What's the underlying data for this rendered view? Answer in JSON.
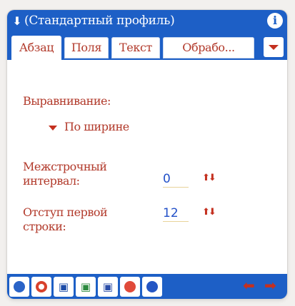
{
  "title_bar": {
    "arrow": "⬇",
    "title": "(Стандартный профиль)",
    "info": "i"
  },
  "tabs": [
    {
      "label": "Абзац",
      "active": true
    },
    {
      "label": "Поля",
      "active": false
    },
    {
      "label": "Текст",
      "active": false
    },
    {
      "label": "Обрабо...",
      "active": false
    }
  ],
  "content": {
    "alignment_label": "Выравнивание:",
    "alignment_value": "По ширине",
    "line_spacing_label_1": "Межстрочный",
    "line_spacing_label_2": "интервал:",
    "line_spacing_value": "0",
    "first_indent_label_1": "Отступ первой",
    "first_indent_label_2": "строки:",
    "first_indent_value": "12",
    "spinner_glyph": "⬆⬇"
  },
  "toolbar": {
    "buttons": [
      "help-icon",
      "stop-icon",
      "save-icon",
      "save-as-icon",
      "merge-icon",
      "record-icon",
      "globe-icon"
    ],
    "nav_back": "⬅",
    "nav_forward": "➡"
  },
  "colors": {
    "accent_blue": "#1d5fc6",
    "label_red": "#b23a2b",
    "value_blue": "#2250c8"
  }
}
